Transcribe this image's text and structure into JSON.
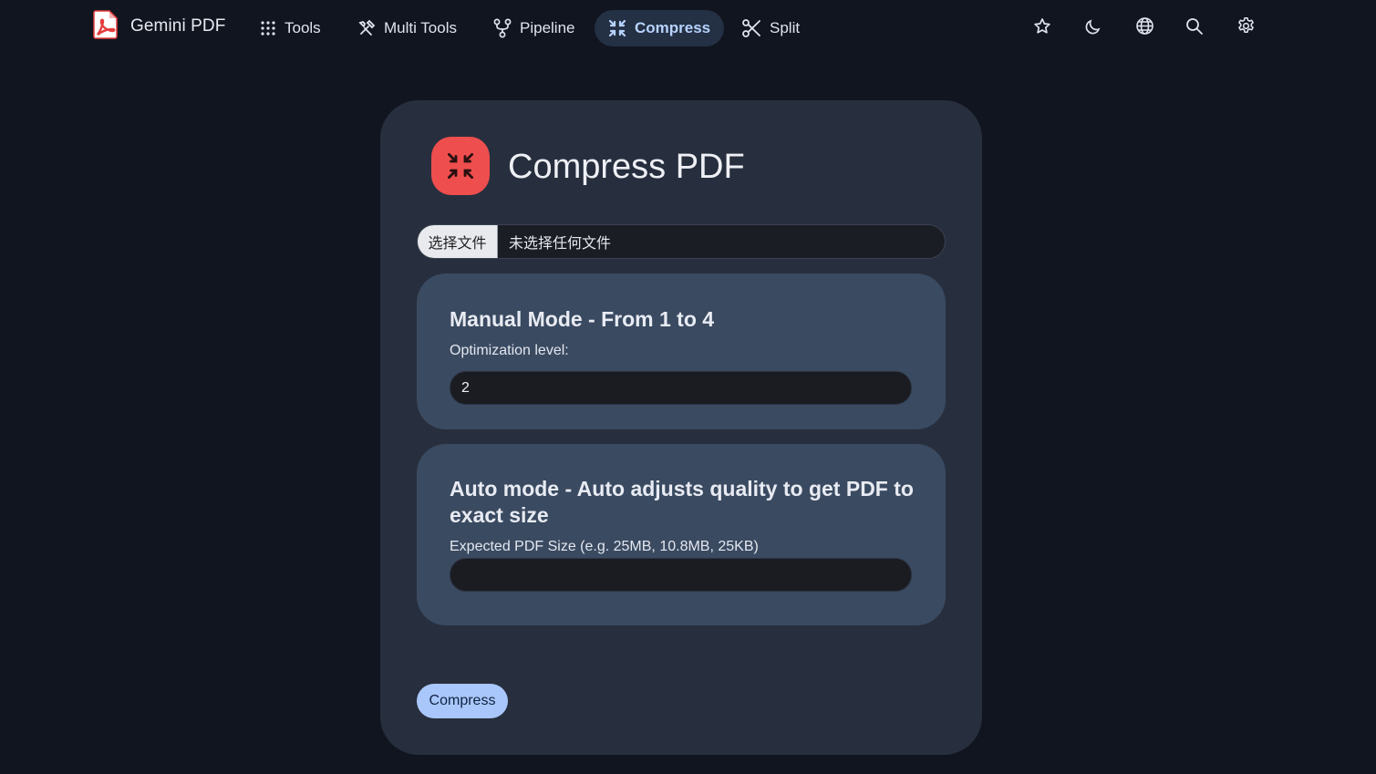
{
  "header": {
    "brand": "Gemini PDF",
    "nav": [
      {
        "label": "Tools",
        "icon": "grid-dots-icon"
      },
      {
        "label": "Multi Tools",
        "icon": "tools-icon"
      },
      {
        "label": "Pipeline",
        "icon": "pipeline-icon"
      },
      {
        "label": "Compress",
        "icon": "compress-icon",
        "active": true
      },
      {
        "label": "Split",
        "icon": "scissors-icon"
      }
    ],
    "actions": [
      "star-icon",
      "moon-icon",
      "globe-icon",
      "search-icon",
      "gear-icon"
    ]
  },
  "card": {
    "title": "Compress PDF",
    "title_icon": "compress-icon",
    "file_input": {
      "button_label": "选择文件",
      "status": "未选择任何文件"
    },
    "manual_mode": {
      "heading": "Manual Mode - From 1 to 4",
      "label": "Optimization level:",
      "value": "2"
    },
    "auto_mode": {
      "heading": "Auto mode - Auto adjusts quality to get PDF to exact size",
      "label": "Expected PDF Size (e.g. 25MB, 10.8MB, 25KB)",
      "value": ""
    },
    "submit_label": "Compress"
  },
  "colors": {
    "background": "#111520",
    "card": "#272f3e",
    "panel": "#3a4a61",
    "accent": "#a9c7fb",
    "active_nav_bg": "#243043",
    "active_nav_text": "#b7d3ff",
    "title_icon_bg": "#ef4e4e"
  }
}
